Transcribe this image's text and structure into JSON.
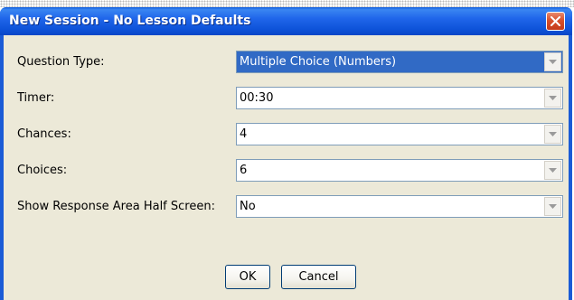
{
  "window": {
    "title": "New Session - No Lesson Defaults"
  },
  "fields": [
    {
      "label": "Question Type:",
      "value": "Multiple Choice (Numbers)",
      "selected": true
    },
    {
      "label": "Timer:",
      "value": "00:30",
      "selected": false
    },
    {
      "label": "Chances:",
      "value": "4",
      "selected": false
    },
    {
      "label": "Choices:",
      "value": "6",
      "selected": false
    },
    {
      "label": "Show Response Area Half Screen:",
      "value": "No",
      "selected": false
    }
  ],
  "buttons": {
    "ok_label": "OK",
    "cancel_label": "Cancel"
  },
  "icons": {
    "close": "close-icon",
    "dropdown": "chevron-down-icon"
  },
  "colors": {
    "titlebar": "#0a58dc",
    "selection": "#316ac5",
    "dialog_bg": "#ece9d8",
    "close_button": "#d7502c"
  }
}
